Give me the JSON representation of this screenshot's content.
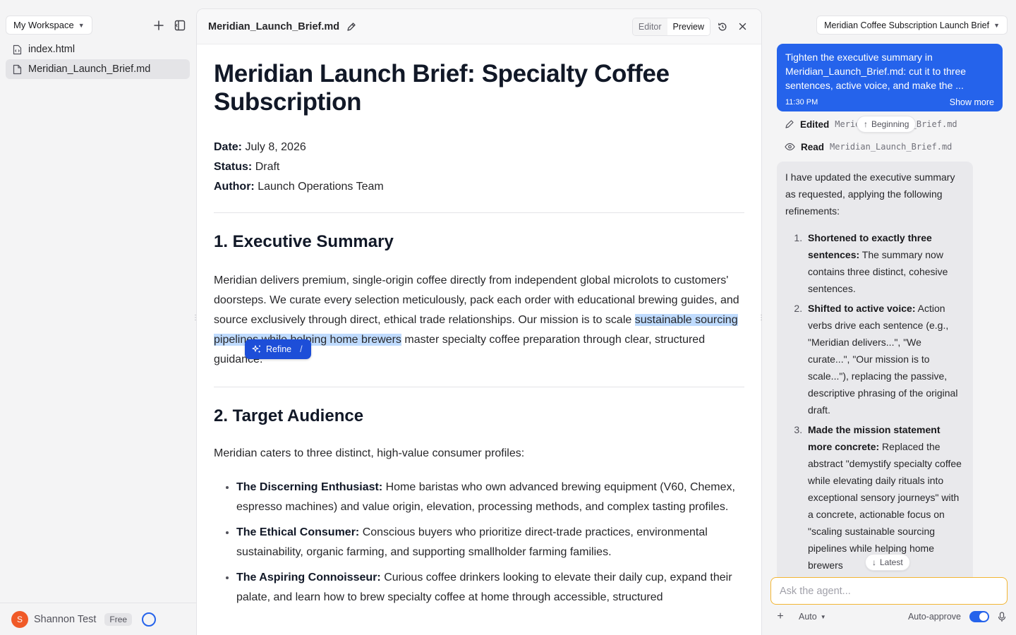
{
  "sidebar": {
    "workspace_label": "My Workspace",
    "files": [
      {
        "name": "index.html",
        "icon": "html-file-icon"
      },
      {
        "name": "Meridian_Launch_Brief.md",
        "icon": "document-icon"
      }
    ],
    "user": {
      "initial": "S",
      "name": "Shannon Test",
      "plan": "Free"
    }
  },
  "editor": {
    "filename": "Meridian_Launch_Brief.md",
    "modes": [
      "Editor",
      "Preview"
    ],
    "active_mode": "Preview",
    "title": "Meridian Launch Brief: Specialty Coffee Subscription",
    "meta": [
      {
        "label": "Date:",
        "value": "July 8, 2026"
      },
      {
        "label": "Status:",
        "value": "Draft"
      },
      {
        "label": "Author:",
        "value": "Launch Operations Team"
      }
    ],
    "section1": {
      "heading": "1. Executive Summary",
      "text_before": "Meridian delivers premium, single-origin coffee directly from independent global microlots to customers' doorsteps. We curate every selection meticulously, pack each order with educational brewing guides, and source exclusively through direct, ethical trade relationships. Our mission is to scale ",
      "text_highlight": "sustainable sourcing pipelines while helping home brewers",
      "text_after": " master specialty coffee preparation through clear, structured guidance."
    },
    "refine": {
      "label": "Refine",
      "shortcut": "/"
    },
    "section2": {
      "heading": "2. Target Audience",
      "intro": "Meridian caters to three distinct, high-value consumer profiles:",
      "bullets": [
        {
          "bold": "The Discerning Enthusiast:",
          "text": " Home baristas who own advanced brewing equipment (V60, Chemex, espresso machines) and value origin, elevation, processing methods, and complex tasting profiles."
        },
        {
          "bold": "The Ethical Consumer:",
          "text": " Conscious buyers who prioritize direct-trade practices, environmental sustainability, organic farming, and supporting smallholder farming families."
        },
        {
          "bold": "The Aspiring Connoisseur:",
          "text": " Curious coffee drinkers looking to elevate their daily cup, expand their palate, and learn how to brew specialty coffee at home through accessible, structured"
        }
      ]
    }
  },
  "chat": {
    "thread_title": "Meridian Coffee Subscription Launch Brief",
    "user_message": {
      "text": "Tighten the executive summary in Meridian_Launch_Brief.md: cut it to three sentences, active voice, and make the ...",
      "time": "11:30 PM",
      "show_more": "Show more"
    },
    "tools": [
      {
        "action": "Edited",
        "target": "Meridian_Launch_Brief.md",
        "icon": "pencil-icon"
      },
      {
        "action": "Read",
        "target": "Meridian_Launch_Brief.md",
        "icon": "eye-icon"
      }
    ],
    "jump_beginning": "Beginning",
    "jump_latest": "Latest",
    "assistant": {
      "intro": "I have updated the executive summary as requested, applying the following refinements:",
      "items": [
        {
          "bold": "Shortened to exactly three sentences:",
          "text": " The summary now contains three distinct, cohesive sentences."
        },
        {
          "bold": "Shifted to active voice:",
          "text": " Action verbs drive each sentence (e.g., \"Meridian delivers...\", \"We curate...\", \"Our mission is to scale...\"), replacing the passive, descriptive phrasing of the original draft."
        },
        {
          "bold": "Made the mission statement more concrete:",
          "text": " Replaced the abstract \"demystify specialty coffee while elevating daily rituals into exceptional sensory journeys\" with a concrete, actionable focus on \"scaling sustainable sourcing pipelines while helping home brewers"
        }
      ]
    },
    "input_placeholder": "Ask the agent...",
    "model": "Auto",
    "auto_approve_label": "Auto-approve",
    "auto_approve_on": true
  },
  "colors": {
    "accent": "#2563eb",
    "input_focus": "#f2b634",
    "avatar": "#f05a28"
  }
}
